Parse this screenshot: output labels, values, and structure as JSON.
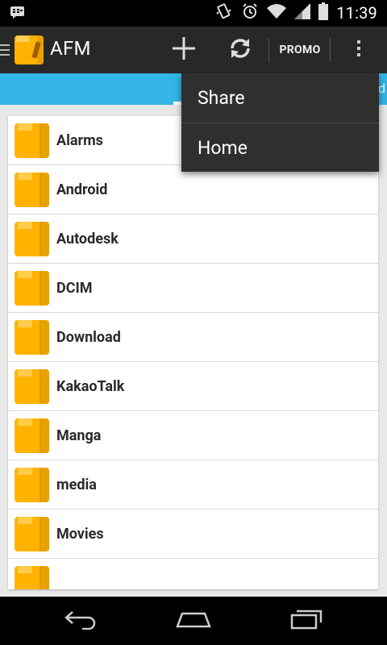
{
  "status_bar": {
    "time": "11:39",
    "icons": [
      "bbm-notification-icon",
      "vibrate-icon",
      "alarm-icon",
      "wifi-icon",
      "signal-icon",
      "battery-icon"
    ]
  },
  "action_bar": {
    "title": "AFM",
    "promo_label": "PROMO",
    "icons": [
      "menu-icon",
      "app-logo-icon",
      "add-icon",
      "refresh-icon",
      "overflow-icon"
    ]
  },
  "overflow_menu": {
    "items": [
      {
        "label": "Share"
      },
      {
        "label": "Home"
      }
    ]
  },
  "file_list": {
    "items": [
      {
        "name": "Alarms"
      },
      {
        "name": "Android"
      },
      {
        "name": "Autodesk"
      },
      {
        "name": "DCIM"
      },
      {
        "name": "Download"
      },
      {
        "name": "KakaoTalk"
      },
      {
        "name": "Manga"
      },
      {
        "name": "media"
      },
      {
        "name": "Movies"
      },
      {
        "name": ""
      }
    ]
  },
  "nav_bar": {
    "icons": [
      "back-icon",
      "home-icon",
      "recent-apps-icon"
    ]
  },
  "colors": {
    "accent_blue": "#33b5e5",
    "folder_orange": "#ffb300",
    "action_bar": "#282828",
    "menu_bg": "#2f2f2f"
  }
}
